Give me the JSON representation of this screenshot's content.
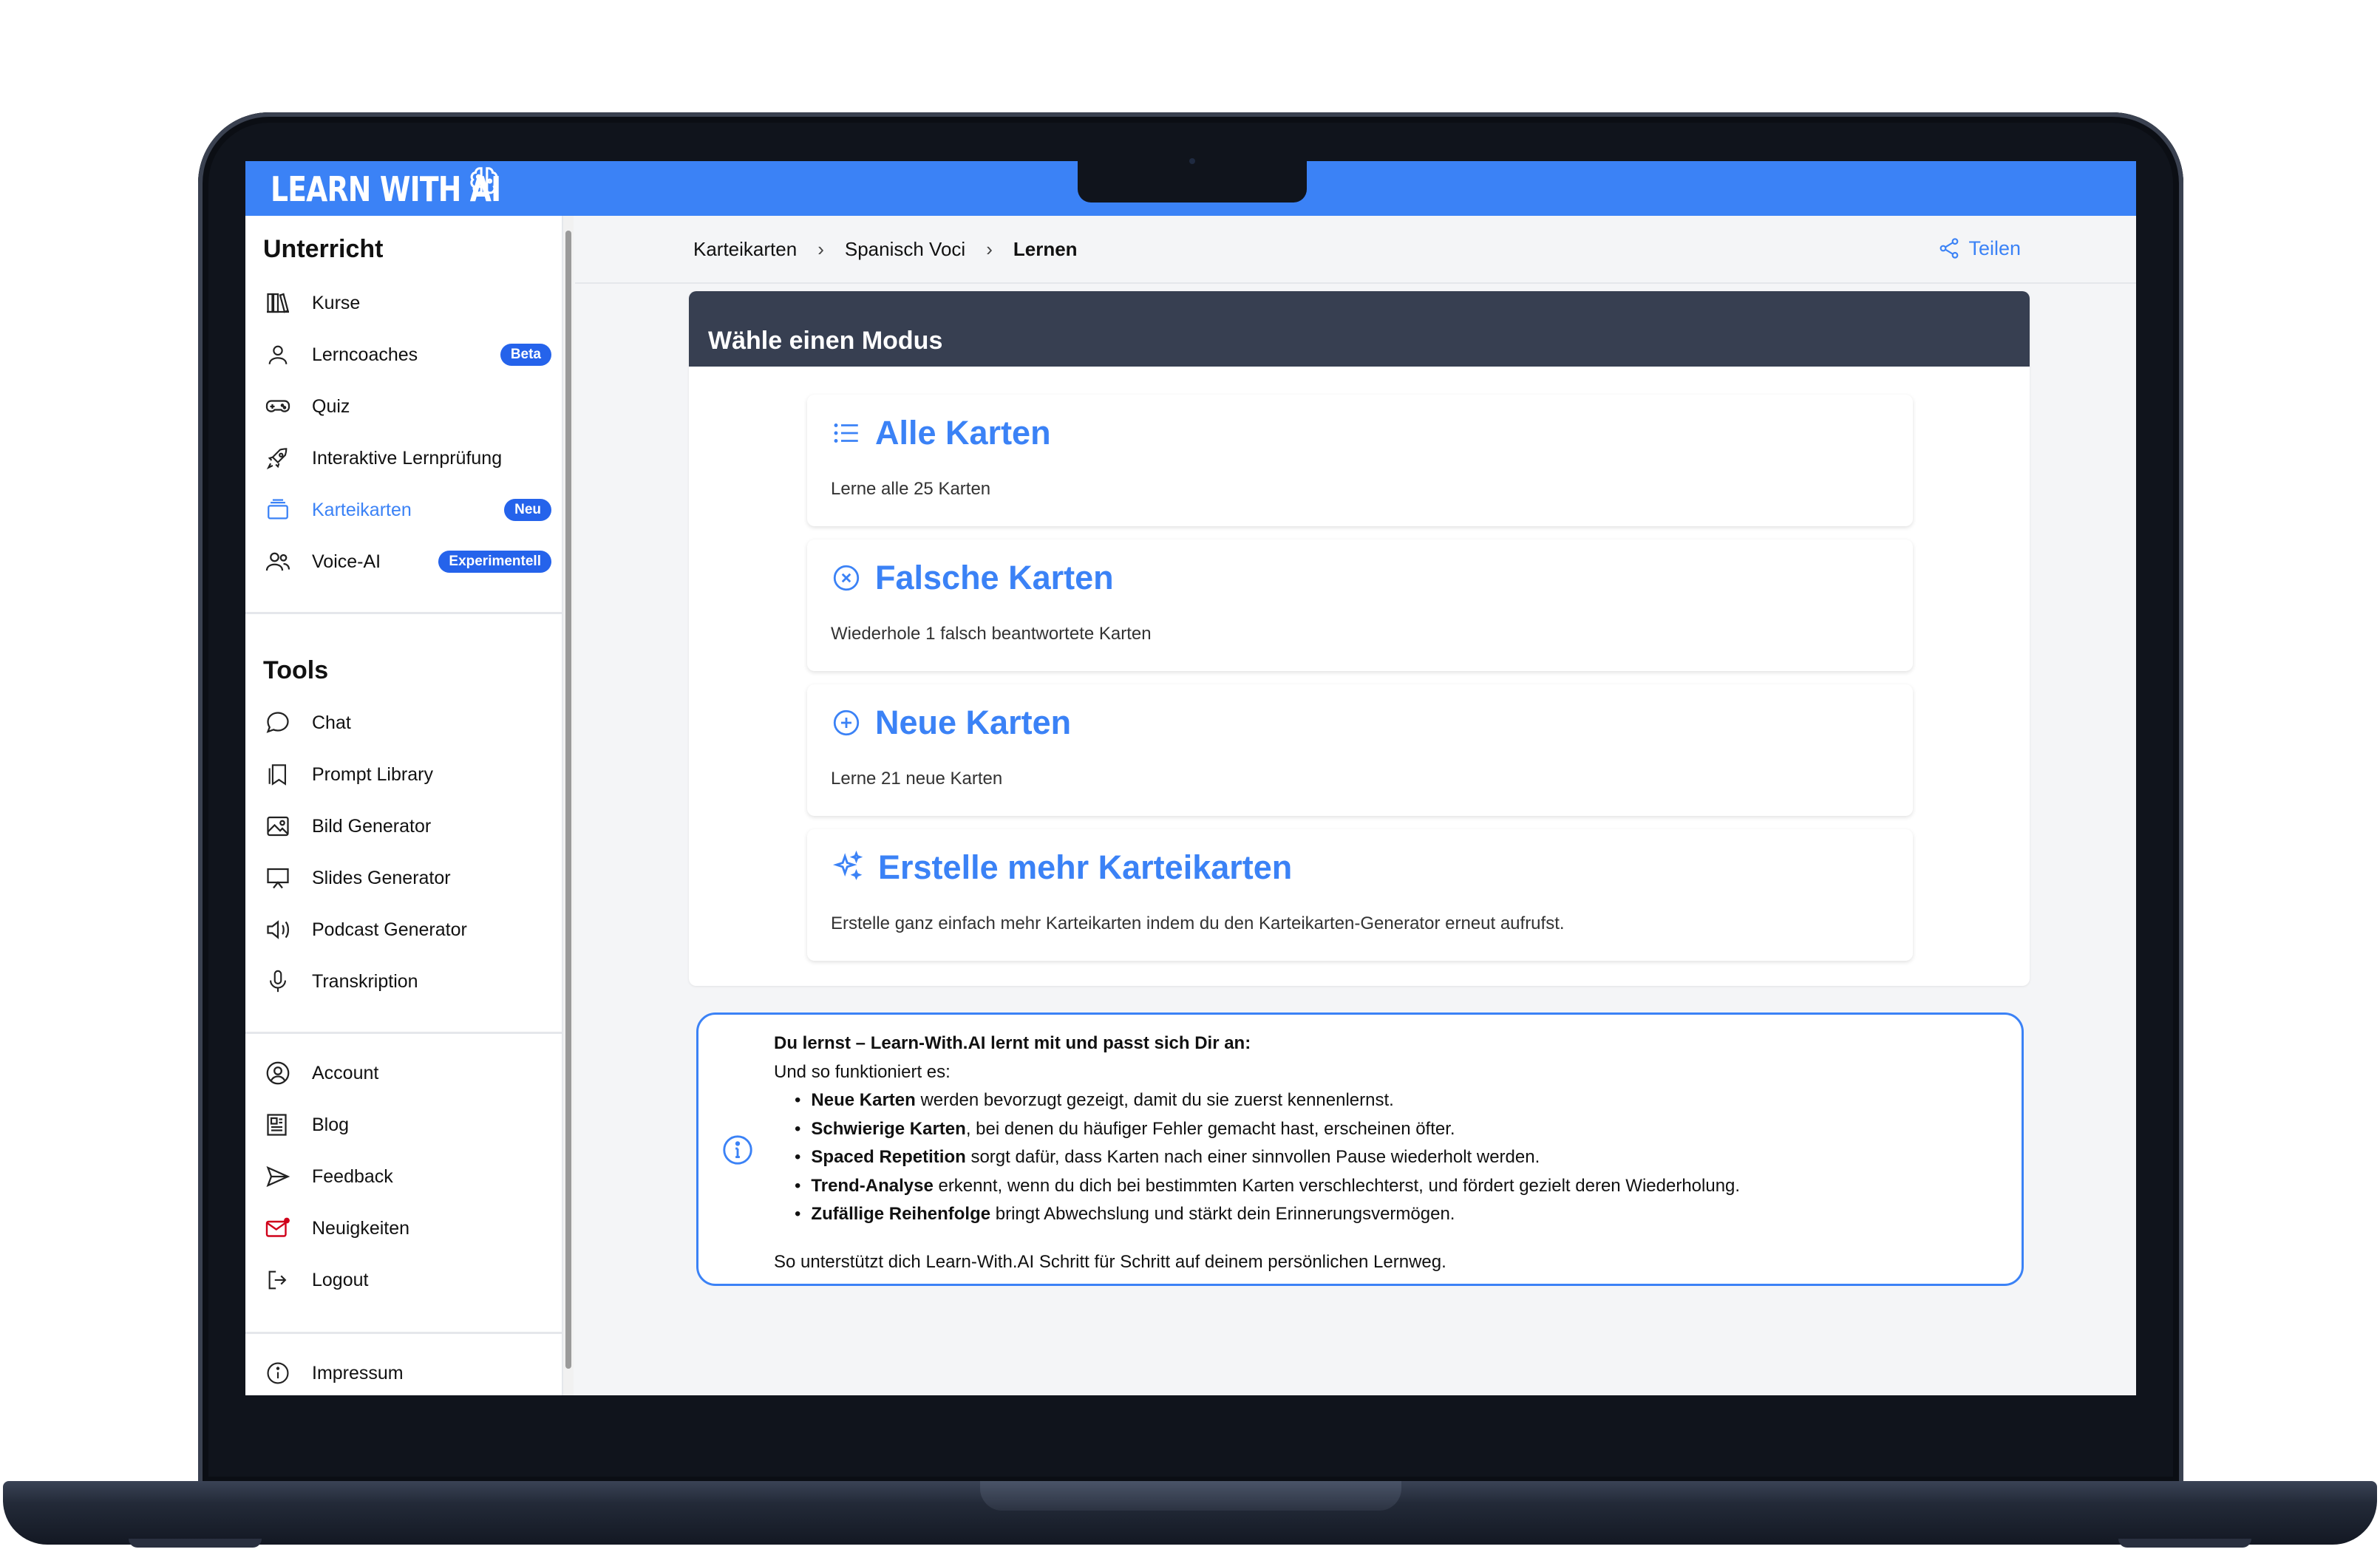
{
  "app": {
    "logo_text": "LEARN WITH AI"
  },
  "breadcrumb": {
    "items": [
      "Karteikarten",
      "Spanisch Voci"
    ],
    "current": "Lernen",
    "separator": "›"
  },
  "share": {
    "label": "Teilen"
  },
  "sidebar": {
    "unterricht_title": "Unterricht",
    "unterricht": [
      {
        "label": "Kurse",
        "icon": "books-icon"
      },
      {
        "label": "Lerncoaches",
        "icon": "user-icon",
        "badge": "Beta"
      },
      {
        "label": "Quiz",
        "icon": "gamepad-icon"
      },
      {
        "label": "Interaktive Lernprüfung",
        "icon": "rocket-icon"
      },
      {
        "label": "Karteikarten",
        "icon": "cards-icon",
        "badge": "Neu",
        "active": true
      },
      {
        "label": "Voice-AI",
        "icon": "users-icon",
        "badge": "Experimentell"
      }
    ],
    "tools_title": "Tools",
    "tools": [
      {
        "label": "Chat",
        "icon": "chat-icon"
      },
      {
        "label": "Prompt Library",
        "icon": "bookmark-icon"
      },
      {
        "label": "Bild Generator",
        "icon": "image-icon"
      },
      {
        "label": "Slides Generator",
        "icon": "presentation-icon"
      },
      {
        "label": "Podcast Generator",
        "icon": "speaker-icon"
      },
      {
        "label": "Transkription",
        "icon": "microphone-icon"
      }
    ],
    "account": [
      {
        "label": "Account",
        "icon": "account-icon"
      },
      {
        "label": "Blog",
        "icon": "newspaper-icon"
      },
      {
        "label": "Feedback",
        "icon": "send-icon"
      },
      {
        "label": "Neuigkeiten",
        "icon": "mail-notification-icon"
      },
      {
        "label": "Logout",
        "icon": "logout-icon"
      }
    ],
    "footer": [
      {
        "label": "Impressum",
        "icon": "info-icon"
      }
    ]
  },
  "modes": {
    "header": "Wähle einen Modus",
    "cards": [
      {
        "title": "Alle Karten",
        "description": "Lerne alle 25 Karten",
        "icon": "list-icon"
      },
      {
        "title": "Falsche Karten",
        "description": "Wiederhole 1 falsch beantwortete Karten",
        "icon": "x-circle-icon"
      },
      {
        "title": "Neue Karten",
        "description": "Lerne 21 neue Karten",
        "icon": "plus-circle-icon"
      },
      {
        "title": "Erstelle mehr Karteikarten",
        "description": "Erstelle ganz einfach mehr Karteikarten indem du den Karteikarten-Generator erneut aufrufst.",
        "icon": "sparkles-icon"
      }
    ]
  },
  "info": {
    "title": "Du lernst – Learn-With.AI lernt mit und passt sich Dir an:",
    "intro": "Und so funktioniert es:",
    "items": [
      {
        "bold": "Neue Karten",
        "text": " werden bevorzugt gezeigt, damit du sie zuerst kennenlernst."
      },
      {
        "bold": "Schwierige Karten",
        "text": ", bei denen du häufiger Fehler gemacht hast, erscheinen öfter."
      },
      {
        "bold": "Spaced Repetition",
        "text": " sorgt dafür, dass Karten nach einer sinnvollen Pause wiederholt werden."
      },
      {
        "bold": "Trend-Analyse",
        "text": " erkennt, wenn du dich bei bestimmten Karten verschlechterst, und fördert gezielt deren Wiederholung."
      },
      {
        "bold": "Zufällige Reihenfolge",
        "text": " bringt Abwechslung und stärkt dein Erinnerungsvermögen."
      }
    ],
    "footer": "So unterstützt dich Learn-With.AI Schritt für Schritt auf deinem persönlichen Lernweg."
  },
  "colors": {
    "accent": "#3b82f6",
    "header_dark": "#373f51",
    "badge": "#2563eb"
  }
}
